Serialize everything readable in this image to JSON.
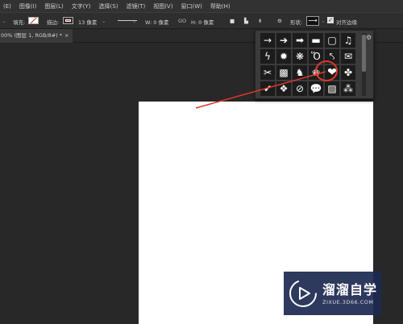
{
  "menu": [
    "(E)",
    "图像(I)",
    "图层(L)",
    "文字(Y)",
    "选择(S)",
    "滤镜(T)",
    "视图(V)",
    "窗口(W)",
    "帮助(H)"
  ],
  "options": {
    "fill_label": "填充:",
    "stroke_label": "描边:",
    "stroke_size": "13 像素",
    "w_label": "W: 0 像素",
    "link_icon": "GO",
    "h_label": "H: 0 像素",
    "shape_label": "形状:",
    "align_edges_label": "对齐边缘",
    "colors": {
      "fill": "#ffffff",
      "stroke": "#e0362c"
    }
  },
  "document_tab": {
    "title": "00% (图层 1, RGB/8#) *",
    "close": "×"
  },
  "shape_picker": {
    "shapes": [
      "→",
      "➔",
      "➡",
      "▬",
      "▢",
      "♫",
      "ϟ",
      "✹",
      "❋",
      "Ὅ",
      "⤣",
      "✉",
      "✂",
      "▩",
      "♞",
      "❀",
      "❤",
      "✤",
      "✔",
      "❖",
      "⊘",
      "💬",
      "▨",
      "⁂"
    ],
    "selected_shape": "❤",
    "gear_icon": "⚙"
  },
  "watermark": {
    "name": "溜溜自学",
    "url": "ZIXUE.3D66.COM"
  },
  "annotation_color": "#e0362c"
}
